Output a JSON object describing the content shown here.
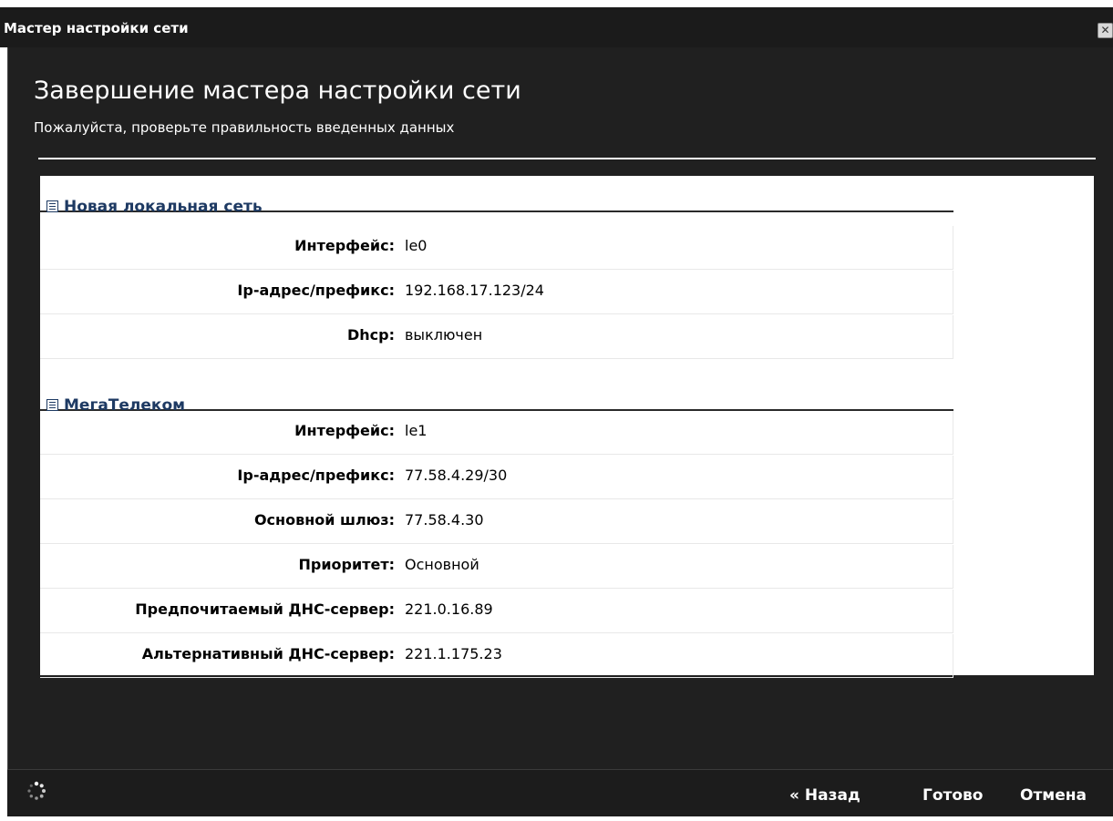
{
  "window": {
    "title": "Мастер настройки сети",
    "close_label": "✕"
  },
  "header": {
    "title": "Завершение мастера настройки сети",
    "subtitle": "Пожалуйста, проверьте правильность введенных данных"
  },
  "sections": [
    {
      "title": "Новая локальная сеть",
      "rows": [
        {
          "key": "Интерфейс:",
          "value": "le0"
        },
        {
          "key": "Ip-адрес/префикс:",
          "value": "192.168.17.123/24"
        },
        {
          "key": "Dhcp:",
          "value": "выключен"
        }
      ]
    },
    {
      "title": "МегаТелеком",
      "rows": [
        {
          "key": "Интерфейс:",
          "value": "le1"
        },
        {
          "key": "Ip-адрес/префикс:",
          "value": "77.58.4.29/30"
        },
        {
          "key": "Основной шлюз:",
          "value": "77.58.4.30"
        },
        {
          "key": "Приоритет:",
          "value": "Основной"
        },
        {
          "key": "Предпочитаемый ДНС-сервер:",
          "value": "221.0.16.89"
        },
        {
          "key": "Альтернативный ДНС-сервер:",
          "value": "221.1.175.23"
        }
      ]
    }
  ],
  "footer": {
    "back_label": "« Назад",
    "done_label": "Готово",
    "cancel_label": "Отмена",
    "spinner_icon": "loading-spinner-icon"
  }
}
